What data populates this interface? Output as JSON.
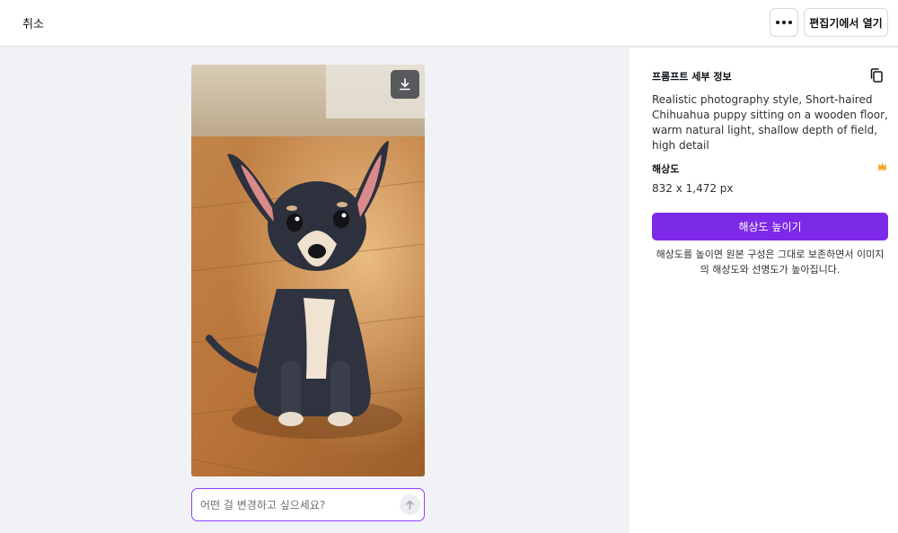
{
  "header": {
    "cancel_label": "취소",
    "open_editor_label": "편집기에서 열기",
    "more_icon": "more-horizontal-icon"
  },
  "canvas": {
    "image_alt": "Short-haired Chihuahua puppy sitting on a wooden floor",
    "download_icon": "download-icon",
    "prompt_placeholder": "어떤 걸 변경하고 싶으세요?",
    "send_icon": "arrow-up-icon"
  },
  "panel": {
    "prompt_title": "프롬프트 세부 정보",
    "prompt_text": "Realistic photography style, Short-haired Chihuahua puppy sitting on a wooden floor, warm natural light, shallow depth of field, high detail",
    "resolution_title": "해상도",
    "resolution_value": "832 x 1,472 px",
    "upscale_button": "해상도 높이기",
    "upscale_note": "해상도를 높이면 원본 구성은 그대로 보존하면서 이미지의 해상도와 선명도가 높아집니다."
  },
  "colors": {
    "accent": "#7d2ae8",
    "focus_border": "#8b3dff",
    "crown": "#f5a623"
  }
}
